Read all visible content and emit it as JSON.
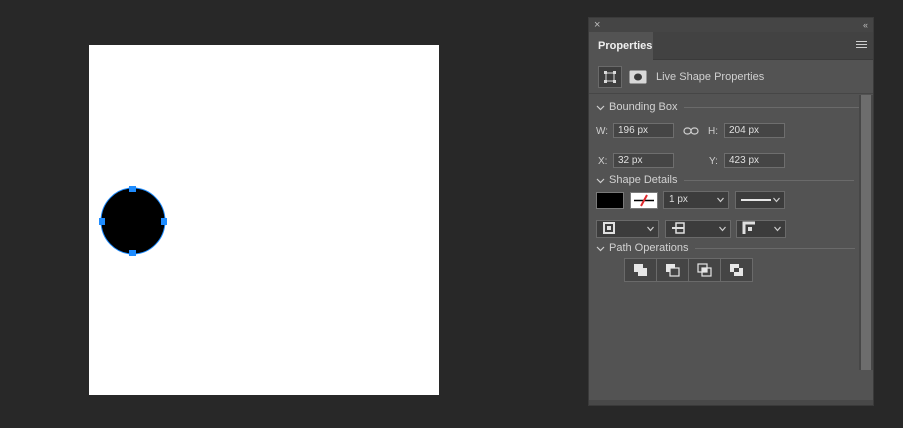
{
  "canvas": {
    "background": "#ffffff",
    "shape": {
      "type": "ellipse",
      "fill": "#000000",
      "selection_color": "#1e8cff"
    }
  },
  "panel": {
    "close_glyph": "×",
    "collapse_glyph": "‹‹",
    "tab": "Properties",
    "menu_icon": "hamburger-menu-icon",
    "live_shape_label": "Live Shape Properties",
    "sections": {
      "bounding_box": "Bounding Box",
      "shape_details": "Shape Details",
      "path_operations": "Path Operations"
    },
    "bounding": {
      "w_label": "W:",
      "w_value": "196 px",
      "h_label": "H:",
      "h_value": "204 px",
      "x_label": "X:",
      "x_value": "32 px",
      "y_label": "Y:",
      "y_value": "423 px"
    },
    "shape_details": {
      "fill_color": "#000000",
      "stroke_color": "none",
      "stroke_width": "1 px",
      "stroke_style": "solid"
    },
    "path_ops": [
      "combine-shapes-icon",
      "subtract-front-shape-icon",
      "intersect-shape-areas-icon",
      "exclude-overlapping-shapes-icon"
    ]
  }
}
